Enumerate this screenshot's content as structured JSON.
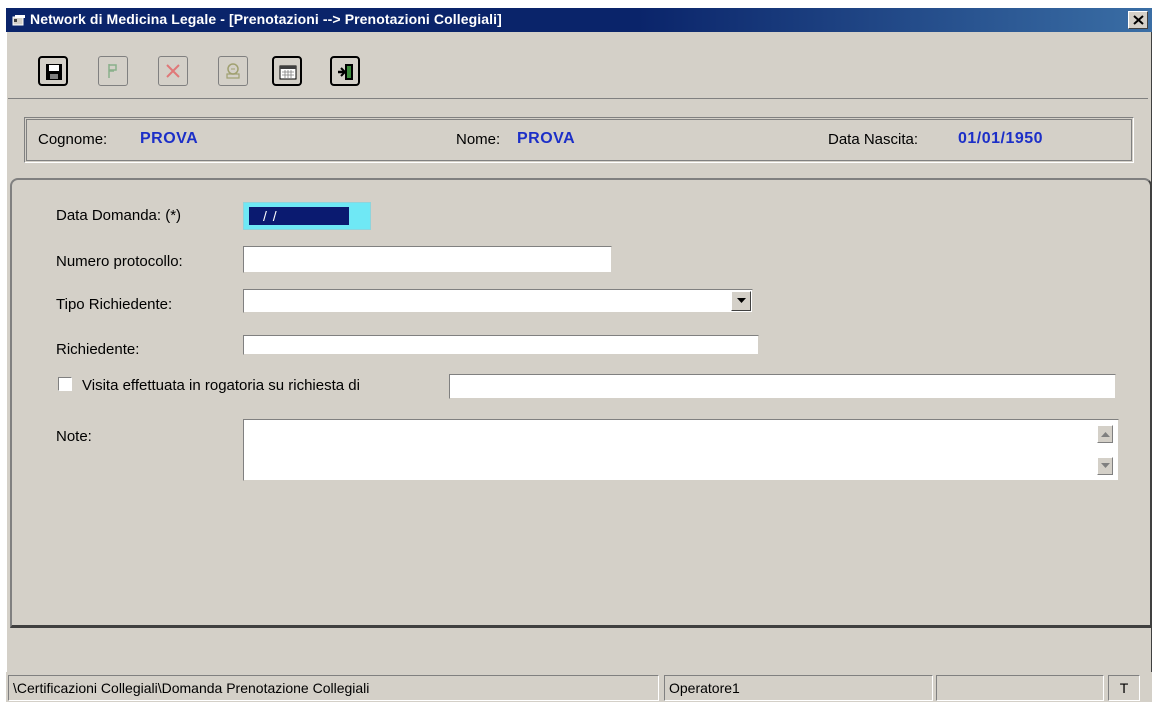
{
  "window": {
    "title": "Network di Medicina Legale - [Prenotazioni --> Prenotazioni Collegiali]",
    "close_label": "✕"
  },
  "toolbar": {
    "buttons": [
      {
        "icon": "floppy-disk-icon",
        "enabled": true
      },
      {
        "icon": "flag-icon",
        "enabled": false
      },
      {
        "icon": "delete-x-icon",
        "enabled": false
      },
      {
        "icon": "print-preview-icon",
        "enabled": false
      },
      {
        "icon": "calendar-icon",
        "enabled": true
      },
      {
        "icon": "exit-door-icon",
        "enabled": true
      }
    ]
  },
  "patient": {
    "surname_label": "Cognome:",
    "surname": "PROVA",
    "name_label": "Nome:",
    "name": "PROVA",
    "birthdate_label": "Data Nascita:",
    "birthdate": "01/01/1950"
  },
  "form": {
    "data_domanda_label": "Data Domanda: (*)",
    "data_domanda_value": " /  / ",
    "numero_protocollo_label": "Numero protocollo:",
    "numero_protocollo_value": "",
    "tipo_richiedente_label": "Tipo Richiedente:",
    "tipo_richiedente_value": "",
    "richiedente_label": "Richiedente:",
    "richiedente_value": "",
    "rogatoria_label": "Visita effettuata in rogatoria  su richiesta di",
    "rogatoria_checked": false,
    "rogatoria_value": "",
    "note_label": "Note:",
    "note_value": ""
  },
  "statusbar": {
    "path": "\\Certificazioni Collegiali\\Domanda Prenotazione Collegiali",
    "operator": "Operatore1",
    "empty_panel": "",
    "indicator": "T"
  },
  "colors": {
    "titlebar": "#0a246a",
    "window_bg": "#d4d0c8",
    "value_blue": "#1c2fc8",
    "date_highlight": "#6fe8f5"
  }
}
